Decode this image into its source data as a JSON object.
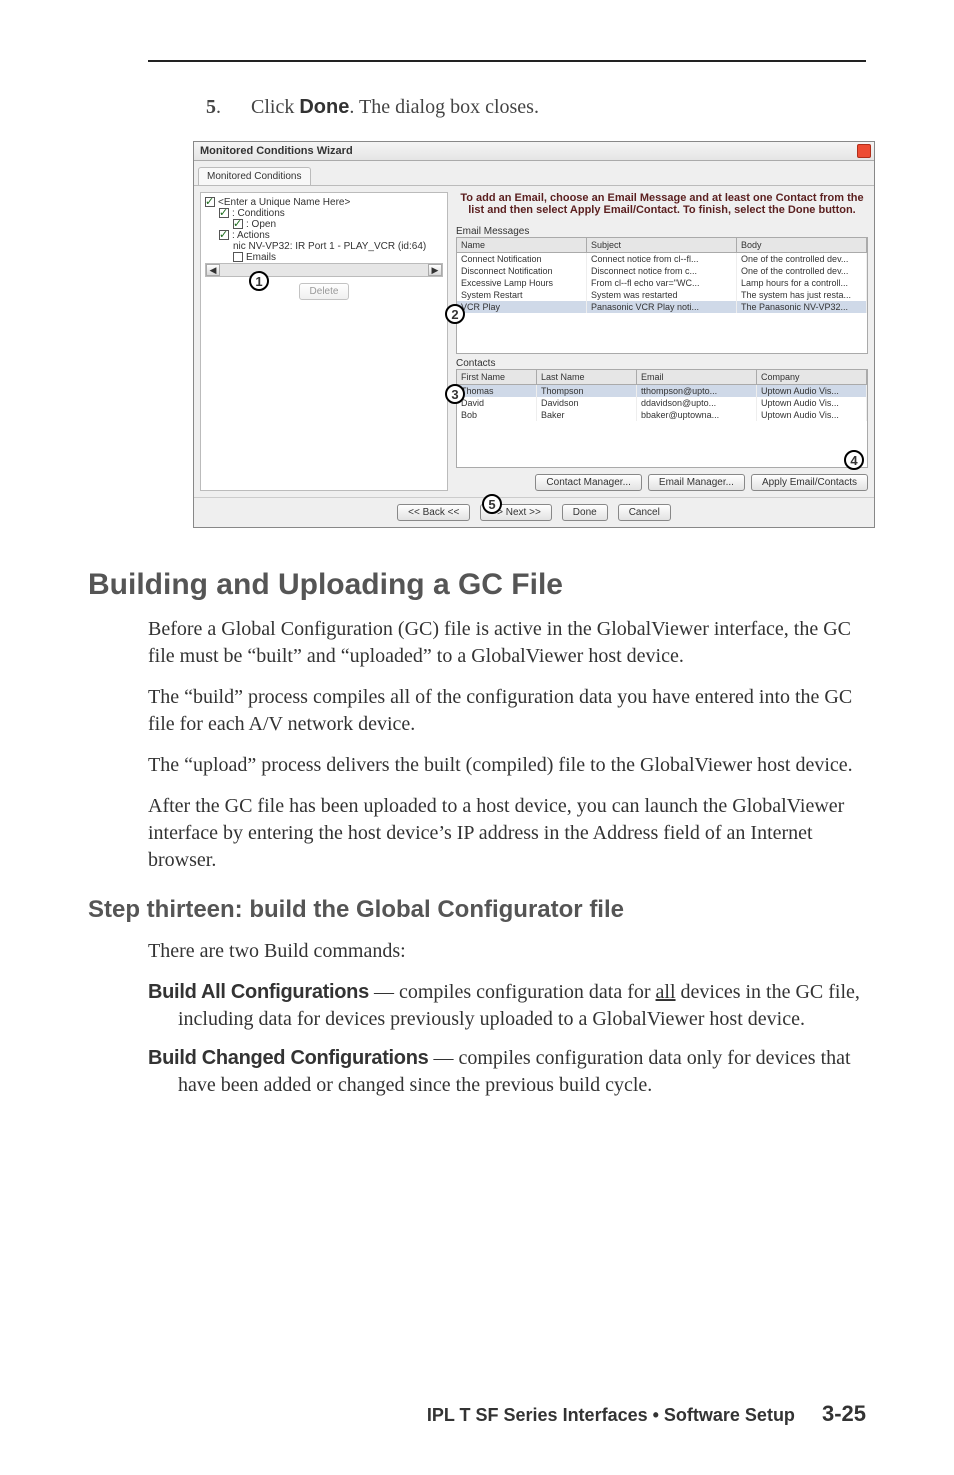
{
  "step": {
    "number": "5",
    "prefix": ".",
    "text_a": "Click ",
    "bold": "Done",
    "text_b": ".  The dialog box closes."
  },
  "dialog": {
    "title": "Monitored Conditions Wizard",
    "tab": "Monitored Conditions",
    "tree": {
      "root": "<Enter a Unique Name Here>",
      "n1": ": Conditions",
      "n2": ": Open",
      "n3": ": Actions",
      "n4": "nic NV-VP32: IR Port 1 - PLAY_VCR (id:64)",
      "n5": "Emails"
    },
    "instructions": "To add an Email, choose an Email Message and at least one Contact from the list and then select Apply Email/Contact. To finish, select the Done button.",
    "emails_label": "Email Messages",
    "emails": {
      "h1": "Name",
      "h2": "Subject",
      "h3": "Body",
      "rows": [
        {
          "c1": "Connect Notification",
          "c2": "Connect notice from cl--fl...",
          "c3": "One of the controlled dev..."
        },
        {
          "c1": "Disconnect Notification",
          "c2": "Disconnect notice from c...",
          "c3": "One of the controlled dev..."
        },
        {
          "c1": "Excessive Lamp Hours",
          "c2": "From cl--fl echo var=\"WC...",
          "c3": "Lamp hours for a controll..."
        },
        {
          "c1": "System Restart",
          "c2": "System was restarted",
          "c3": "The system has just resta..."
        }
      ],
      "hilite": {
        "c1": "VCR Play",
        "c2": "Panasonic VCR Play noti...",
        "c3": "The Panasonic NV-VP32..."
      }
    },
    "contacts_label": "Contacts",
    "contacts": {
      "h1": "First Name",
      "h2": "Last Name",
      "h3": "Email",
      "h4": "Company",
      "hilite": {
        "c1": "Thomas",
        "c2": "Thompson",
        "c3": "tthompson@upto...",
        "c4": "Uptown Audio Vis..."
      },
      "rows": [
        {
          "c1": "David",
          "c2": "Davidson",
          "c3": "ddavidson@upto...",
          "c4": "Uptown Audio Vis..."
        },
        {
          "c1": "Bob",
          "c2": "Baker",
          "c3": "bbaker@uptowna...",
          "c4": "Uptown Audio Vis..."
        }
      ]
    },
    "buttons": {
      "contact_mgr": "Contact Manager...",
      "email_mgr": "Email Manager...",
      "apply": "Apply Email/Contacts",
      "back": "<< Back <<",
      "next": ">> Next >>",
      "done": "Done",
      "cancel": "Cancel",
      "delete": "Delete"
    },
    "callouts": {
      "c1": "1",
      "c2": "2",
      "c3": "3",
      "c4": "4",
      "c5": "5"
    }
  },
  "h1": "Building and Uploading a GC File",
  "p1": "Before a Global Configuration (GC) file is active in the GlobalViewer interface, the GC file must be “built” and “uploaded” to a GlobalViewer host device.",
  "p2": "The “build” process compiles all of the configuration data you have entered into the GC file for each A/V network device.",
  "p3": "The “upload” process delivers the built (compiled) file to the GlobalViewer host device.",
  "p4": "After the GC file has been uploaded to a host device, you can launch the GlobalViewer interface by entering the host device’s IP address in the Address field of an Internet browser.",
  "h2": "Step thirteen: build the Global Configurator file",
  "p5": "There are two Build commands:",
  "def1": {
    "term": "Build All Configurations",
    "sep": " — compiles configuration data for ",
    "underlined": "all",
    "rest": " devices in the GC file, including data for devices previously uploaded to a GlobalViewer host device."
  },
  "def2": {
    "term": "Build Changed Configurations",
    "rest": " — compiles configuration data only for devices that have been added or changed since the previous build cycle."
  },
  "footer": {
    "text": "IPL T SF Series Interfaces • Software Setup",
    "page": "3-25"
  }
}
